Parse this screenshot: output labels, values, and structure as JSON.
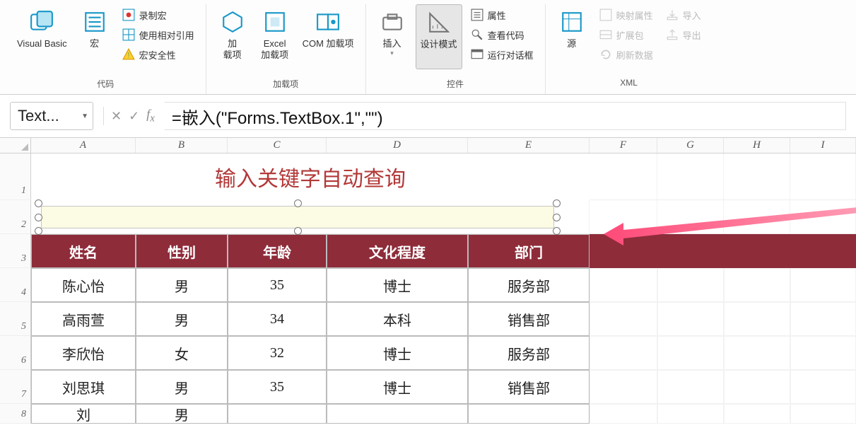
{
  "ribbon": {
    "groups": {
      "code": {
        "label": "代码",
        "visual_basic": "Visual Basic",
        "macros": "宏",
        "record_macro": "录制宏",
        "relative_ref": "使用相对引用",
        "macro_security": "宏安全性"
      },
      "addins": {
        "label": "加载项",
        "addin": "加\n载项",
        "excel_addin": "Excel\n加载项",
        "com_addin": "COM 加载项"
      },
      "controls": {
        "label": "控件",
        "insert": "插入",
        "design_mode": "设计模式",
        "properties": "属性",
        "view_code": "查看代码",
        "run_dialog": "运行对话框"
      },
      "xml": {
        "label": "XML",
        "source": "源",
        "map_properties": "映射属性",
        "expansion_pack": "扩展包",
        "refresh_data": "刷新数据",
        "import": "导入",
        "export": "导出"
      }
    }
  },
  "formula_bar": {
    "name_box": "Text...",
    "formula": "=嵌入(\"Forms.TextBox.1\",\"\")"
  },
  "sheet": {
    "columns": [
      "A",
      "B",
      "C",
      "D",
      "E",
      "F",
      "G",
      "H",
      "I"
    ],
    "title": "输入关键字自动查询",
    "headers": [
      "姓名",
      "性别",
      "年龄",
      "文化程度",
      "部门"
    ],
    "rows": [
      {
        "name": "陈心怡",
        "gender": "男",
        "age": "35",
        "edu": "博士",
        "dept": "服务部"
      },
      {
        "name": "高雨萱",
        "gender": "男",
        "age": "34",
        "edu": "本科",
        "dept": "销售部"
      },
      {
        "name": "李欣怡",
        "gender": "女",
        "age": "32",
        "edu": "博士",
        "dept": "服务部"
      },
      {
        "name": "刘思琪",
        "gender": "男",
        "age": "35",
        "edu": "博士",
        "dept": "销售部"
      },
      {
        "name": "刘",
        "gender": "男",
        "age": "",
        "edu": "",
        "dept": ""
      }
    ]
  }
}
